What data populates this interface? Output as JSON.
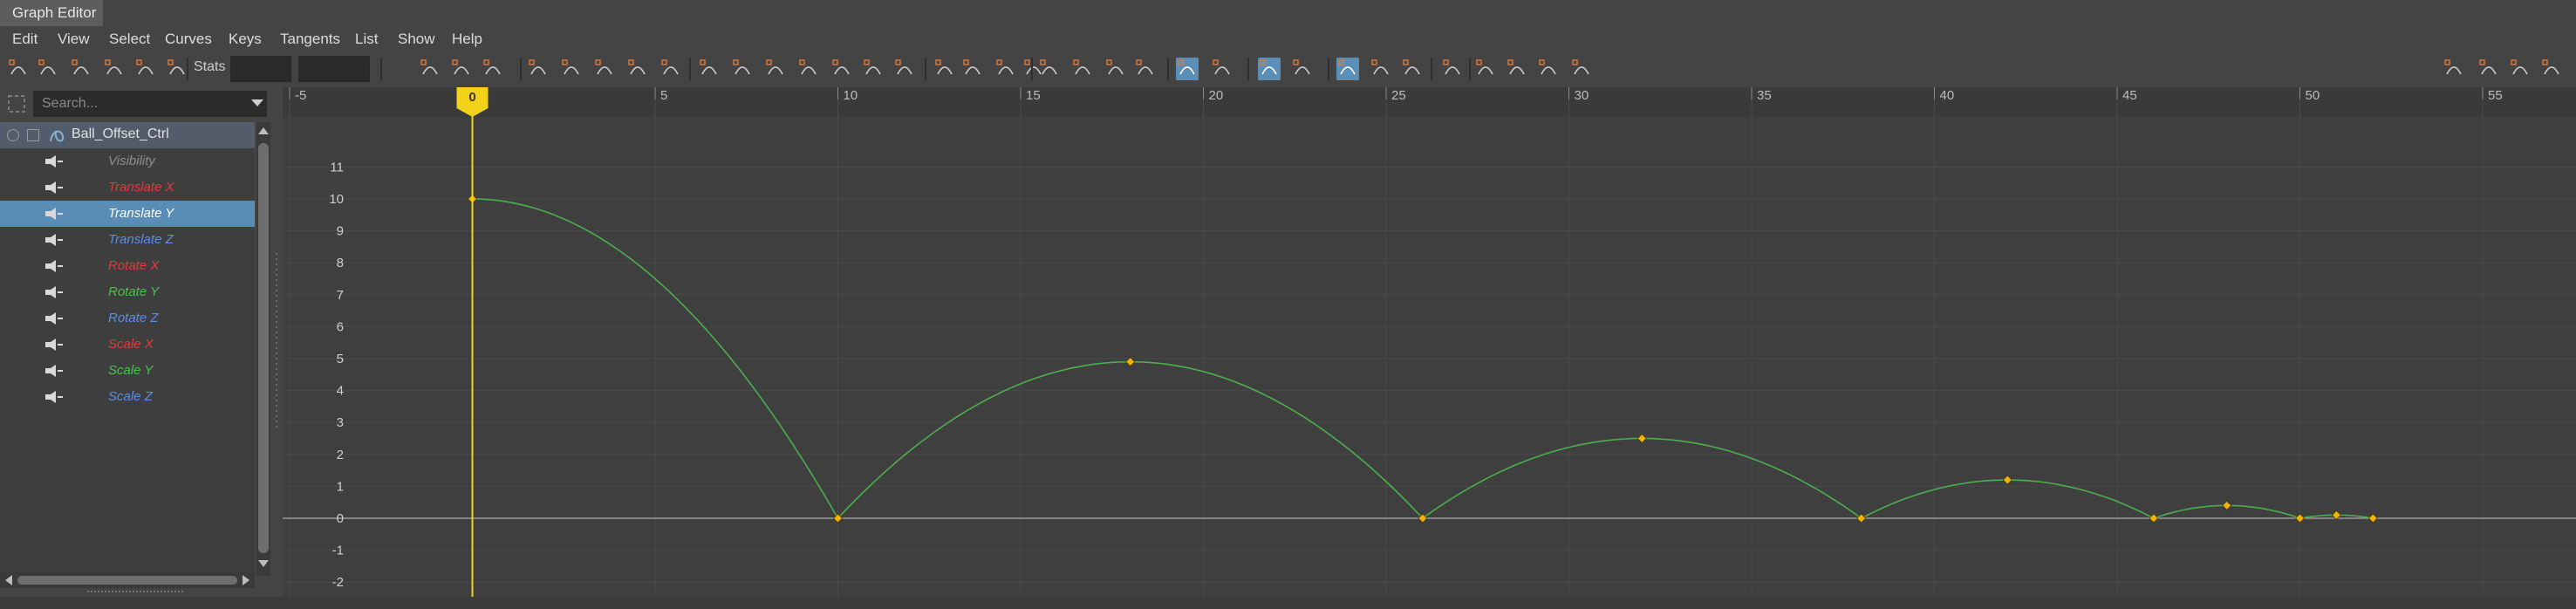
{
  "window": {
    "title": "Graph Editor"
  },
  "menu": [
    "Edit",
    "View",
    "Select",
    "Curves",
    "Keys",
    "Tangents",
    "List",
    "Show",
    "Help"
  ],
  "toolbar": {
    "stats_label": "Stats"
  },
  "search": {
    "placeholder": "Search..."
  },
  "outliner": {
    "node": "Ball_Offset_Ctrl",
    "attributes": [
      {
        "label": "Visibility",
        "color": "#8f8f8f",
        "selected": false
      },
      {
        "label": "Translate X",
        "color": "#e03c3c",
        "selected": false
      },
      {
        "label": "Translate Y",
        "color": "#ffffff",
        "selected": true
      },
      {
        "label": "Translate Z",
        "color": "#5a8fe6",
        "selected": false
      },
      {
        "label": "Rotate X",
        "color": "#e03c3c",
        "selected": false
      },
      {
        "label": "Rotate Y",
        "color": "#4cc24c",
        "selected": false
      },
      {
        "label": "Rotate Z",
        "color": "#5a8fe6",
        "selected": false
      },
      {
        "label": "Scale X",
        "color": "#e03c3c",
        "selected": false
      },
      {
        "label": "Scale Y",
        "color": "#4cc24c",
        "selected": false
      },
      {
        "label": "Scale Z",
        "color": "#5a8fe6",
        "selected": false
      }
    ]
  },
  "graph": {
    "current_frame": "0",
    "x_ticks": [
      "-5",
      "0",
      "5",
      "10",
      "15",
      "20",
      "25",
      "30",
      "35",
      "40",
      "45",
      "50",
      "55"
    ],
    "y_ticks": [
      "11",
      "10",
      "9",
      "8",
      "7",
      "6",
      "5",
      "4",
      "3",
      "2",
      "1",
      "0",
      "-1",
      "-2"
    ],
    "curve_color": "#4cae4c",
    "key_color": "#f0b400",
    "playhead_color": "#f2d21a",
    "keys": [
      {
        "frame": 0,
        "value": 10
      },
      {
        "frame": 10,
        "value": 0
      },
      {
        "frame": 18,
        "value": 4.9
      },
      {
        "frame": 26,
        "value": 0
      },
      {
        "frame": 32,
        "value": 2.5
      },
      {
        "frame": 38,
        "value": 0
      },
      {
        "frame": 42,
        "value": 1.2
      },
      {
        "frame": 46,
        "value": 0
      },
      {
        "frame": 48,
        "value": 0.4
      },
      {
        "frame": 50,
        "value": 0
      },
      {
        "frame": 51,
        "value": 0.1
      },
      {
        "frame": 52,
        "value": 0
      }
    ]
  }
}
